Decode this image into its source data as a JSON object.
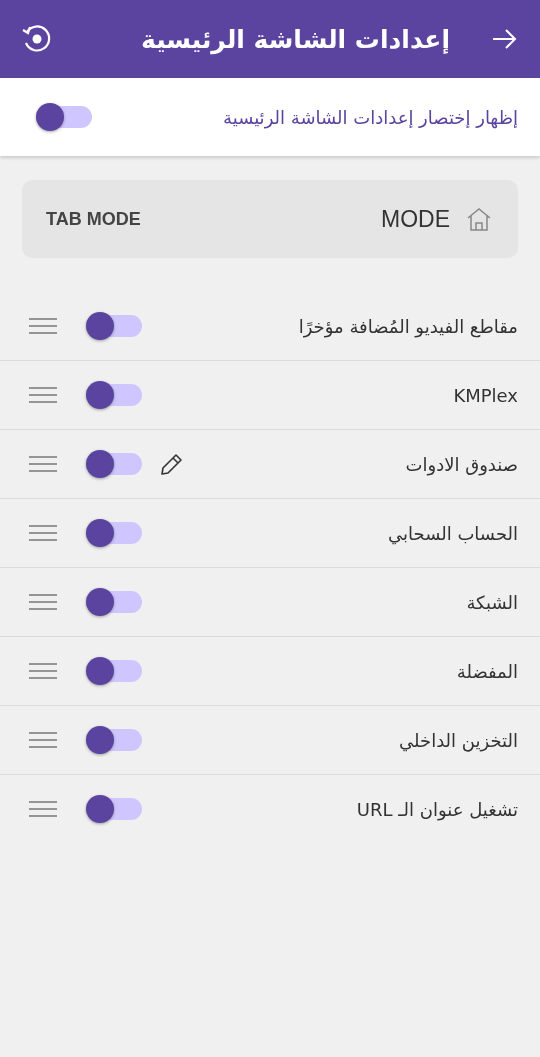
{
  "header": {
    "title": "إعدادات الشاشة الرئيسية"
  },
  "shortcut": {
    "label": "إظهار إختصار إعدادات الشاشة الرئيسية",
    "on": true
  },
  "mode_card": {
    "mode": "MODE",
    "tab_mode": "TAB MODE"
  },
  "items": [
    {
      "label": "مقاطع الفيديو المُضافة مؤخرًا",
      "on": true,
      "editable": false
    },
    {
      "label": "KMPlex",
      "on": true,
      "editable": false
    },
    {
      "label": "صندوق الادوات",
      "on": true,
      "editable": true
    },
    {
      "label": "الحساب السحابي",
      "on": true,
      "editable": false
    },
    {
      "label": "الشبكة",
      "on": true,
      "editable": false
    },
    {
      "label": "المفضلة",
      "on": true,
      "editable": false
    },
    {
      "label": "التخزين الداخلي",
      "on": true,
      "editable": false
    },
    {
      "label": "تشغيل عنوان الـ URL",
      "on": true,
      "editable": false
    }
  ]
}
